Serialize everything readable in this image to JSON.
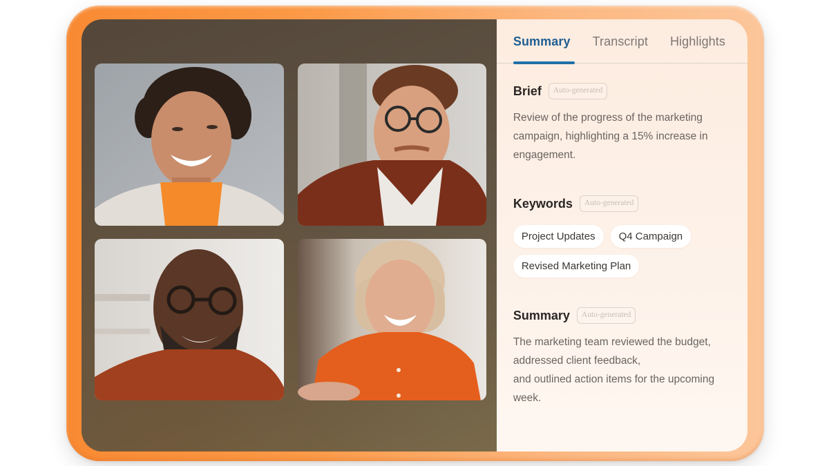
{
  "tabs": [
    {
      "label": "Summary",
      "active": true
    },
    {
      "label": "Transcript",
      "active": false
    },
    {
      "label": "Highlights",
      "active": false
    }
  ],
  "brief": {
    "title": "Brief",
    "badge": "Auto-generated",
    "text": "Review of the progress of the marketing campaign, highlighting a 15% increase in engagement."
  },
  "keywords": {
    "title": "Keywords",
    "badge": "Auto-generated",
    "chips": [
      "Project Updates",
      "Q4 Campaign",
      "Revised Marketing Plan"
    ]
  },
  "summary": {
    "title": "Summary",
    "badge": "Auto-generated",
    "lines": [
      "The marketing team reviewed the budget,",
      "addressed client feedback,",
      "and outlined action items for the upcoming week."
    ]
  },
  "participants": [
    {
      "description": "Woman with curly dark hair, cream blazer, orange top"
    },
    {
      "description": "Man with glasses, brown cardigan, white t-shirt"
    },
    {
      "description": "Bald man with glasses and beard, rust shirt"
    },
    {
      "description": "Blonde woman, orange blouse"
    }
  ],
  "colors": {
    "frame_orange": "#f98a33",
    "tab_active": "#1f6fa8",
    "panel_bg": "#fdf1e8",
    "video_bg": "#5d5142"
  }
}
